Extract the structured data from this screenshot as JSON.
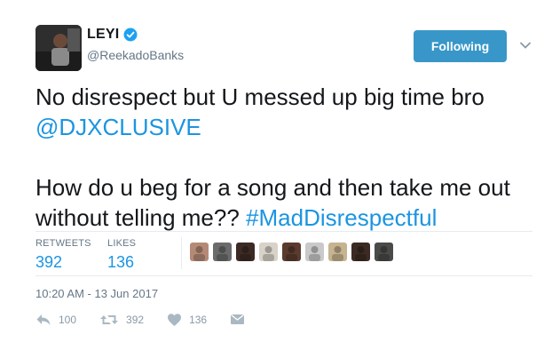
{
  "user": {
    "display_name": "LEYI",
    "handle": "@ReekadoBanks"
  },
  "follow_button": {
    "label": "Following"
  },
  "tweet": {
    "line1": "No disrespect but U messed up big time bro",
    "mention": "@DJXCLUSIVE",
    "line2": "How do u beg for a song and then take me out without telling me?? ",
    "hashtag": "#MadDisrespectful"
  },
  "stats": {
    "retweets_label": "RETWEETS",
    "retweets_value": "392",
    "likes_label": "LIKES",
    "likes_value": "136"
  },
  "likers": [
    {
      "name": "liker-avatar-1",
      "color": "#b48a76"
    },
    {
      "name": "liker-avatar-2",
      "color": "#6b6b6b"
    },
    {
      "name": "liker-avatar-3",
      "color": "#3d2a24"
    },
    {
      "name": "liker-avatar-4",
      "color": "#d8d2c8"
    },
    {
      "name": "liker-avatar-5",
      "color": "#5a3b2e"
    },
    {
      "name": "liker-avatar-6",
      "color": "#c9c9c9"
    },
    {
      "name": "liker-avatar-7",
      "color": "#c7b38f"
    },
    {
      "name": "liker-avatar-8",
      "color": "#3b2b22"
    },
    {
      "name": "liker-avatar-9",
      "color": "#4a4a48"
    }
  ],
  "timestamp": "10:20 AM - 13 Jun 2017",
  "actions": {
    "reply_count": "100",
    "retweet_count": "392",
    "like_count": "136"
  },
  "colors": {
    "link": "#1b95e0",
    "follow_button": "#3897c8",
    "muted": "#657786"
  }
}
